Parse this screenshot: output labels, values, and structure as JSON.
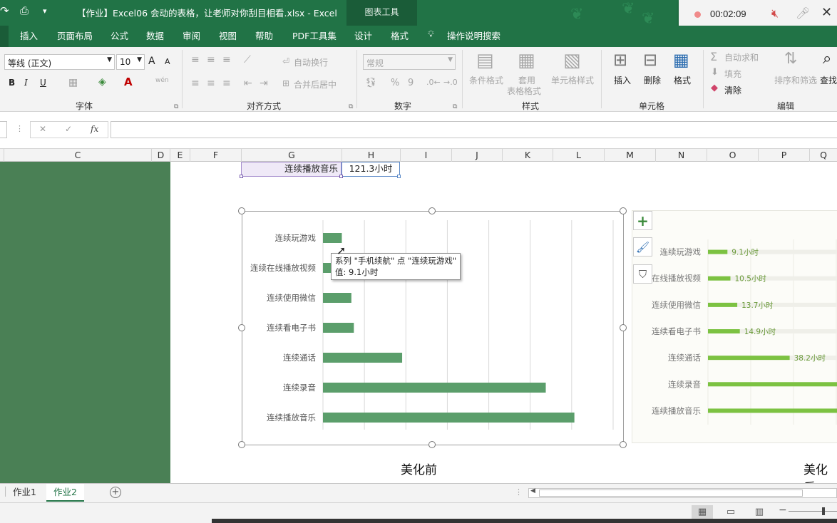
{
  "window": {
    "title": "【作业】Excel06 会动的表格，让老师对你刮目相看.xlsx  -  Excel",
    "context_tools": "图表工具"
  },
  "recorder": {
    "time": "00:02:09"
  },
  "tabs": [
    "插入",
    "页面布局",
    "公式",
    "数据",
    "审阅",
    "视图",
    "帮助",
    "PDF工具集",
    "设计",
    "格式"
  ],
  "tell_me": "操作说明搜索",
  "ribbon": {
    "font_name": "等线 (正文)",
    "font_size": "10",
    "grow_font": "A",
    "shrink_font": "A",
    "bold": "B",
    "italic": "I",
    "underline": "U",
    "phonetic": "wén",
    "group_font": "字体",
    "wrap_text": "自动换行",
    "merge_center": "合并后居中",
    "group_align": "对齐方式",
    "number_format": "常规",
    "percent": "%",
    "comma": "9",
    "group_number": "数字",
    "cond_format": "条件格式",
    "table_format_1": "套用",
    "table_format_2": "表格格式",
    "cell_styles": "单元格样式",
    "group_styles": "样式",
    "insert": "插入",
    "delete": "删除",
    "format": "格式",
    "group_cells": "单元格",
    "autosum": "自动求和",
    "fill": "填充",
    "clear": "清除",
    "sort_filter": "排序和筛选",
    "find": "查找",
    "group_edit": "编辑"
  },
  "formula": {
    "fx": "fx",
    "cancel": "✕",
    "confirm": "✓"
  },
  "columns": [
    "C",
    "D",
    "E",
    "F",
    "G",
    "H",
    "I",
    "J",
    "K",
    "L",
    "M",
    "N",
    "O",
    "P",
    "Q"
  ],
  "cells": {
    "g_value": "连续播放音乐",
    "h_value": "121.3小时"
  },
  "chart_data": [
    {
      "type": "bar",
      "categories": [
        "连续玩游戏",
        "连续在线播放视频",
        "连续使用微信",
        "连续看电子书",
        "连续通话",
        "连续录音",
        "连续播放音乐"
      ],
      "values": [
        9.1,
        10.5,
        13.7,
        14.9,
        38.2,
        107.5,
        121.3
      ],
      "xlim": [
        0,
        140
      ],
      "grid": true,
      "bar_color": "#5b9e6b"
    },
    {
      "type": "bar",
      "categories": [
        "连续玩游戏",
        "连续在线播放视频",
        "连续使用微信",
        "连续看电子书",
        "连续通话",
        "连续录音",
        "连续播放音乐"
      ],
      "category_labels_visible": [
        "连续玩游戏",
        "在线播放视频",
        "连续使用微信",
        "连续看电子书",
        "连续通话",
        "连续录音",
        "连续播放音乐"
      ],
      "values": [
        9.1,
        10.5,
        13.7,
        14.9,
        38.2,
        107.5,
        121.3
      ],
      "data_labels": [
        "9.1小时",
        "10.5小时",
        "13.7小时",
        "14.9小时",
        "38.2小时",
        "",
        ""
      ],
      "xlim": [
        0,
        140
      ],
      "grid": true,
      "bar_color": "#7cc242"
    }
  ],
  "tooltip": {
    "line1": "系列 \"手机续航\" 点 \"连续玩游戏\"",
    "line2": "值: 9.1小时"
  },
  "captions": {
    "before": "美化前",
    "after": "美化后"
  },
  "sheet_tabs": [
    "作业1",
    "作业2"
  ],
  "add_sheet": "+",
  "status": {
    "zoom_minus": "−"
  }
}
